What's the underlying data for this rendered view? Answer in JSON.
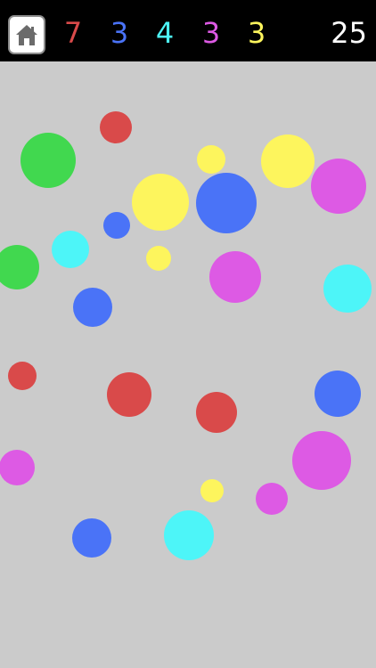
{
  "colors": {
    "red": "#d94a4a",
    "blue": "#4a73f7",
    "cyan": "#4df5f8",
    "magenta": "#dd5ae4",
    "yellow": "#fdf55d",
    "green": "#41d84f"
  },
  "header": {
    "home_icon": "home-icon",
    "counts": [
      {
        "color": "red",
        "value": "7"
      },
      {
        "color": "blue",
        "value": "3"
      },
      {
        "color": "cyan",
        "value": "4"
      },
      {
        "color": "magenta",
        "value": "3"
      },
      {
        "color": "yellow",
        "value": "3"
      }
    ],
    "score": "25"
  },
  "balls": [
    {
      "color": "green",
      "size": "large"
    },
    {
      "color": "red",
      "size": "small"
    },
    {
      "color": "yellow",
      "size": "small"
    },
    {
      "color": "yellow",
      "size": "medium"
    },
    {
      "color": "magenta",
      "size": "large"
    },
    {
      "color": "yellow",
      "size": "large"
    },
    {
      "color": "blue",
      "size": "large"
    },
    {
      "color": "blue",
      "size": "small"
    },
    {
      "color": "cyan",
      "size": "medium"
    },
    {
      "color": "yellow",
      "size": "small"
    },
    {
      "color": "green",
      "size": "medium"
    },
    {
      "color": "magenta",
      "size": "large"
    },
    {
      "color": "cyan",
      "size": "large"
    },
    {
      "color": "blue",
      "size": "medium"
    },
    {
      "color": "red",
      "size": "small"
    },
    {
      "color": "red",
      "size": "medium"
    },
    {
      "color": "red",
      "size": "medium"
    },
    {
      "color": "blue",
      "size": "medium"
    },
    {
      "color": "magenta",
      "size": "medium"
    },
    {
      "color": "magenta",
      "size": "large"
    },
    {
      "color": "yellow",
      "size": "small"
    },
    {
      "color": "magenta",
      "size": "small"
    },
    {
      "color": "blue",
      "size": "medium"
    },
    {
      "color": "cyan",
      "size": "large"
    }
  ]
}
